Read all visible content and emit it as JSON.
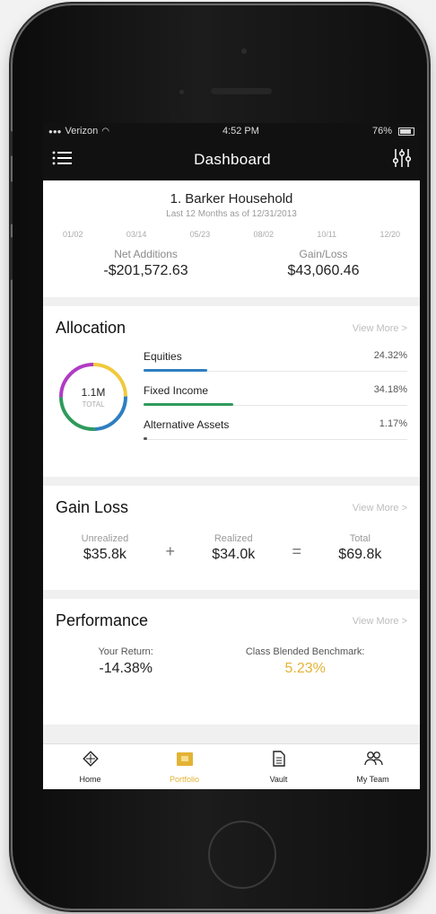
{
  "status": {
    "carrier": "Verizon",
    "time": "4:52 PM",
    "battery": "76%"
  },
  "nav": {
    "title": "Dashboard",
    "menu_icon": "hamburger-icon",
    "filter_icon": "sliders-icon"
  },
  "summary": {
    "household": "1. Barker Household",
    "subtitle": "Last 12 Months as of 12/31/2013",
    "dates": [
      "01/02",
      "03/14",
      "05/23",
      "08/02",
      "10/11",
      "12/20"
    ],
    "net_additions_label": "Net Additions",
    "net_additions_value": "-$201,572.63",
    "gain_loss_label": "Gain/Loss",
    "gain_loss_value": "$43,060.46"
  },
  "allocation": {
    "title": "Allocation",
    "view_more": "View More >",
    "total_value": "1.1M",
    "total_label": "TOTAL",
    "items": [
      {
        "name": "Equities",
        "percent": "24.32%",
        "fill": 0.24,
        "color": "#2e7fc1"
      },
      {
        "name": "Fixed Income",
        "percent": "34.18%",
        "fill": 0.34,
        "color": "#2e9a5b"
      },
      {
        "name": "Alternative Assets",
        "percent": "1.17%",
        "fill": 0.012,
        "color": "#555555"
      }
    ]
  },
  "gain_loss": {
    "title": "Gain Loss",
    "view_more": "View More >",
    "unrealized_label": "Unrealized",
    "unrealized_value": "$35.8k",
    "plus": "+",
    "realized_label": "Realized",
    "realized_value": "$34.0k",
    "equals": "=",
    "total_label": "Total",
    "total_value": "$69.8k"
  },
  "performance": {
    "title": "Performance",
    "view_more": "View More >",
    "your_return_label": "Your Return:",
    "your_return_value": "-14.38%",
    "benchmark_label": "Class Blended Benchmark:",
    "benchmark_value": "5.23%"
  },
  "tabs": [
    {
      "label": "Home",
      "icon": "compass-icon",
      "active": false
    },
    {
      "label": "Portfolio",
      "icon": "portfolio-icon",
      "active": true
    },
    {
      "label": "Vault",
      "icon": "document-icon",
      "active": false
    },
    {
      "label": "My Team",
      "icon": "team-icon",
      "active": false
    }
  ],
  "colors": {
    "accent_gold": "#e3b335",
    "nav_bg": "#111111"
  }
}
